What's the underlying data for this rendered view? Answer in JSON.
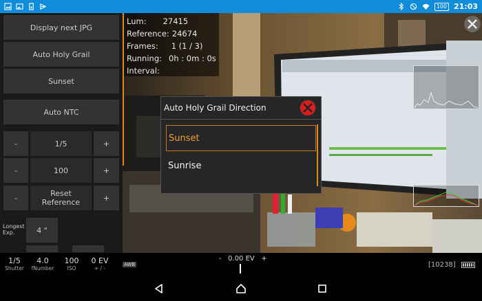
{
  "status_bar": {
    "time": "21:03",
    "battery": "100"
  },
  "left_panel": {
    "display_next_jpg": "Display next JPG",
    "auto_holy_grail": "Auto Holy Grail",
    "sunset": "Sunset",
    "auto_ntc": "Auto NTC",
    "minus": "-",
    "plus": "+",
    "shutter_value": "1/5",
    "iso_value": "100",
    "reset_reference_line1": "Reset",
    "reset_reference_line2": "Reference",
    "longest_exp_line1": "Longest",
    "longest_exp_line2": "Exp.",
    "longest_exp_value": "4 \""
  },
  "info": {
    "lum_label": "Lum:",
    "lum_value": "27415",
    "reference_label": "Reference:",
    "reference_value": "24674",
    "frames_label": "Frames:",
    "frames_value": "1 (1 / 3)",
    "running_label": "Running:",
    "running_value": "0h : 0m : 0s",
    "interval_label": "Interval:",
    "interval_value": ""
  },
  "dialog": {
    "title": "Auto Holy Grail Direction",
    "options": [
      {
        "label": "Sunset",
        "selected": true
      },
      {
        "label": "Sunrise",
        "selected": false
      }
    ]
  },
  "bottom_bar": {
    "shutter": {
      "value": "1/5",
      "label": "Shutter"
    },
    "fnumber": {
      "value": "4.0",
      "label": "fNumber"
    },
    "iso": {
      "value": "100",
      "label": "ISO"
    },
    "ev_comp": {
      "value": "0 EV",
      "label": "+ / -"
    },
    "awb": "AWB",
    "ev_minus": "-",
    "ev_value": "0.00 EV",
    "ev_plus": "+",
    "counter": "[10238]"
  },
  "colors": {
    "status_bar": "#0f8ddb",
    "accent": "#e08a1e",
    "button": "#333333",
    "close_red": "#d81e1e"
  }
}
